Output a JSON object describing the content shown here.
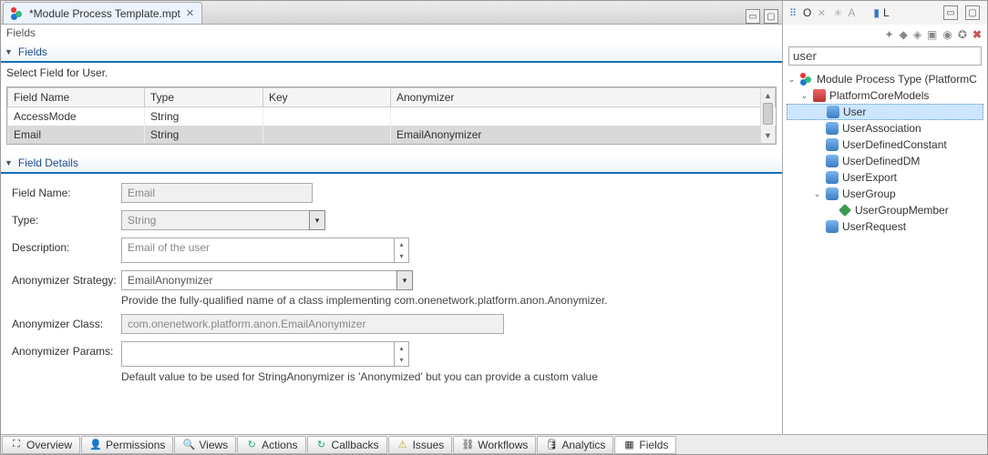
{
  "editor": {
    "tab_title": "*Module Process Template.mpt",
    "breadcrumb": "Fields"
  },
  "fields_section": {
    "title": "Fields",
    "select_msg": "Select Field for User.",
    "columns": {
      "c1": "Field Name",
      "c2": "Type",
      "c3": "Key",
      "c4": "Anonymizer"
    },
    "rows": [
      {
        "name": "AccessMode",
        "type": "String",
        "key": "",
        "anonymizer": ""
      },
      {
        "name": "Email",
        "type": "String",
        "key": "",
        "anonymizer": "EmailAnonymizer"
      }
    ]
  },
  "details_section": {
    "title": "Field Details",
    "field_name_label": "Field Name:",
    "field_name_value": "Email",
    "type_label": "Type:",
    "type_value": "String",
    "desc_label": "Description:",
    "desc_value": "Email of the user",
    "strat_label": "Anonymizer Strategy:",
    "strat_value": "EmailAnonymizer",
    "strat_hint": "Provide the fully-qualified name of a class implementing com.onenetwork.platform.anon.Anonymizer.",
    "class_label": "Anonymizer Class:",
    "class_value": "com.onenetwork.platform.anon.EmailAnonymizer",
    "params_label": "Anonymizer Params:",
    "params_value": "",
    "params_hint": "Default value to be used for StringAnonymizer is 'Anonymized' but you can provide a custom value"
  },
  "bottom_tabs": {
    "overview": "Overview",
    "permissions": "Permissions",
    "views": "Views",
    "actions": "Actions",
    "callbacks": "Callbacks",
    "issues": "Issues",
    "workflows": "Workflows",
    "analytics": "Analytics",
    "fields": "Fields"
  },
  "outline": {
    "toolbar": {
      "o_label": "O",
      "a_label": "A",
      "l_label": "L"
    },
    "filter": "user",
    "root": "Module Process Type (PlatformC",
    "model_group": "PlatformCoreModels",
    "items": [
      "User",
      "UserAssociation",
      "UserDefinedConstant",
      "UserDefinedDM",
      "UserExport",
      "UserGroup",
      "UserGroupMember",
      "UserRequest"
    ]
  }
}
